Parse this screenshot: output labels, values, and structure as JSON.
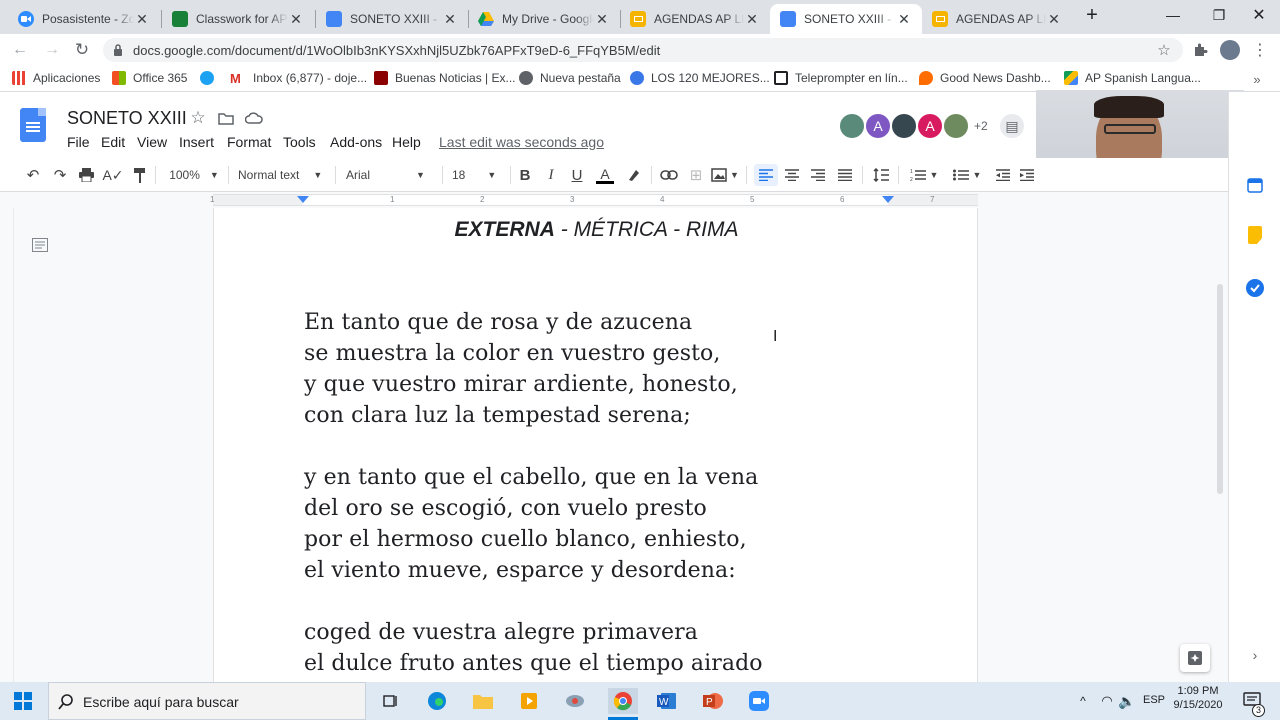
{
  "tabs": [
    {
      "label": "Posasistente - Zoom",
      "fav": "zoom-icon",
      "color": "#2d8cff"
    },
    {
      "label": "Classwork for AP S",
      "fav": "classroom-icon",
      "color": "#188038"
    },
    {
      "label": "SONETO XXIII - Google Docs",
      "fav": "docs-icon",
      "color": "#4285f4"
    },
    {
      "label": "My Drive - Google Drive",
      "fav": "drive-icon",
      "color": "#fbbc04"
    },
    {
      "label": "AGENDAS AP LIT",
      "fav": "slides-icon",
      "color": "#f4b400"
    },
    {
      "label": "SONETO XXIII - Google Docs",
      "fav": "docs-icon",
      "color": "#4285f4"
    },
    {
      "label": "AGENDAS AP LIT",
      "fav": "slides-icon",
      "color": "#f4b400"
    }
  ],
  "url": "docs.google.com/document/d/1WoOlbIb3nKYSXxhNjl5UZbk76APFxT9eD-6_FFqYB5M/edit",
  "bookmarks": [
    {
      "label": "Aplicaciones",
      "color": "#ea4335"
    },
    {
      "label": "Office 365",
      "color": "#e74c3c"
    },
    {
      "label": "",
      "color": "#1da1f2"
    },
    {
      "label": "Inbox (6,877) - doje...",
      "color": "#d93025"
    },
    {
      "label": "Buenas Noticias | Ex...",
      "color": "#8b0000"
    },
    {
      "label": "Nueva pestaña",
      "color": "#5f6368"
    },
    {
      "label": "LOS 120 MEJORES...",
      "color": "#3b78e7"
    },
    {
      "label": "Teleprompter en lín...",
      "color": "#202124"
    },
    {
      "label": "Good News Dashb...",
      "color": "#ff6d00"
    },
    {
      "label": "AP Spanish Langua...",
      "color": "#0f9d58"
    }
  ],
  "doc": {
    "title": "SONETO XXIII",
    "menus": [
      "File",
      "Edit",
      "View",
      "Insert",
      "Format",
      "Tools",
      "Add-ons",
      "Help"
    ],
    "last_edit": "Last edit was seconds ago",
    "collab_more": "+2"
  },
  "toolbar": {
    "zoom": "100%",
    "style": "Normal text",
    "font": "Arial",
    "size": "18"
  },
  "page": {
    "heading_bold": "EXTERNA",
    "heading_rest": " - MÉTRICA - RIMA",
    "stanzas": [
      [
        "En tanto que de rosa y de azucena",
        "se muestra la color en vuestro gesto,",
        "y que vuestro mirar ardiente, honesto,",
        "con clara luz la tempestad serena;"
      ],
      [
        "y en tanto que el cabello, que en la vena",
        "del oro se escogió, con vuelo presto",
        "por el hermoso cuello blanco, enhiesto,",
        "el viento mueve, esparce y desordena:"
      ],
      [
        "coged de vuestra alegre primavera",
        "el dulce fruto antes que el tiempo airado"
      ]
    ]
  },
  "taskbar": {
    "search_placeholder": "Escribe aquí para buscar",
    "lang": "ESP",
    "time": "1:09 PM",
    "date": "9/15/2020",
    "notif_count": "3"
  },
  "ruler_marks": [
    "1",
    "1",
    "2",
    "3",
    "4",
    "5",
    "6",
    "7"
  ]
}
